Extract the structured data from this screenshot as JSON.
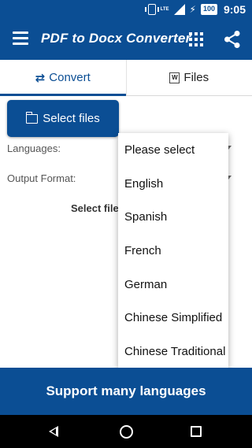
{
  "status_bar": {
    "network": "LTE",
    "battery": "100",
    "time": "9:05"
  },
  "app_bar": {
    "title": "PDF to Docx Converter",
    "menu_icon": "hamburger-icon",
    "apps_icon": "grid-icon",
    "share_icon": "share-icon"
  },
  "tabs": [
    {
      "label": "Convert",
      "icon": "swap-arrows-icon",
      "active": true
    },
    {
      "label": "Files",
      "icon": "word-document-icon",
      "active": false
    }
  ],
  "main": {
    "select_button_label": "Select files",
    "languages_label": "Languages:",
    "output_format_label": "Output Format:",
    "hint_text": "Select file"
  },
  "dropdown": {
    "options": [
      "Please select",
      "English",
      "Spanish",
      "French",
      "German",
      "Chinese Simplified",
      "Chinese Traditional"
    ]
  },
  "banner": {
    "text": "Support many languages"
  },
  "colors": {
    "primary": "#0b4e94",
    "nav_bar": "#000000"
  }
}
